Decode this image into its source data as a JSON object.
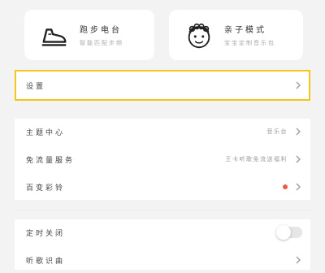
{
  "cards": {
    "left": {
      "title": "跑步电台",
      "subtitle": "智能匹配步频",
      "icon": "running-shoe-icon"
    },
    "right": {
      "title": "亲子模式",
      "subtitle": "宝宝定制音乐包",
      "icon": "baby-face-icon"
    }
  },
  "settings": {
    "label": "设置"
  },
  "menu": [
    {
      "label": "主题中心",
      "value": "音乐台"
    },
    {
      "label": "免流量服务",
      "value": "王卡听歌免流送福利"
    },
    {
      "label": "百变彩铃",
      "value": ""
    }
  ],
  "menu2": [
    {
      "label": "定时关闭"
    },
    {
      "label": "听歌识曲"
    }
  ],
  "colors": {
    "highlight": "#f5c518",
    "badge": "#f0564a"
  }
}
